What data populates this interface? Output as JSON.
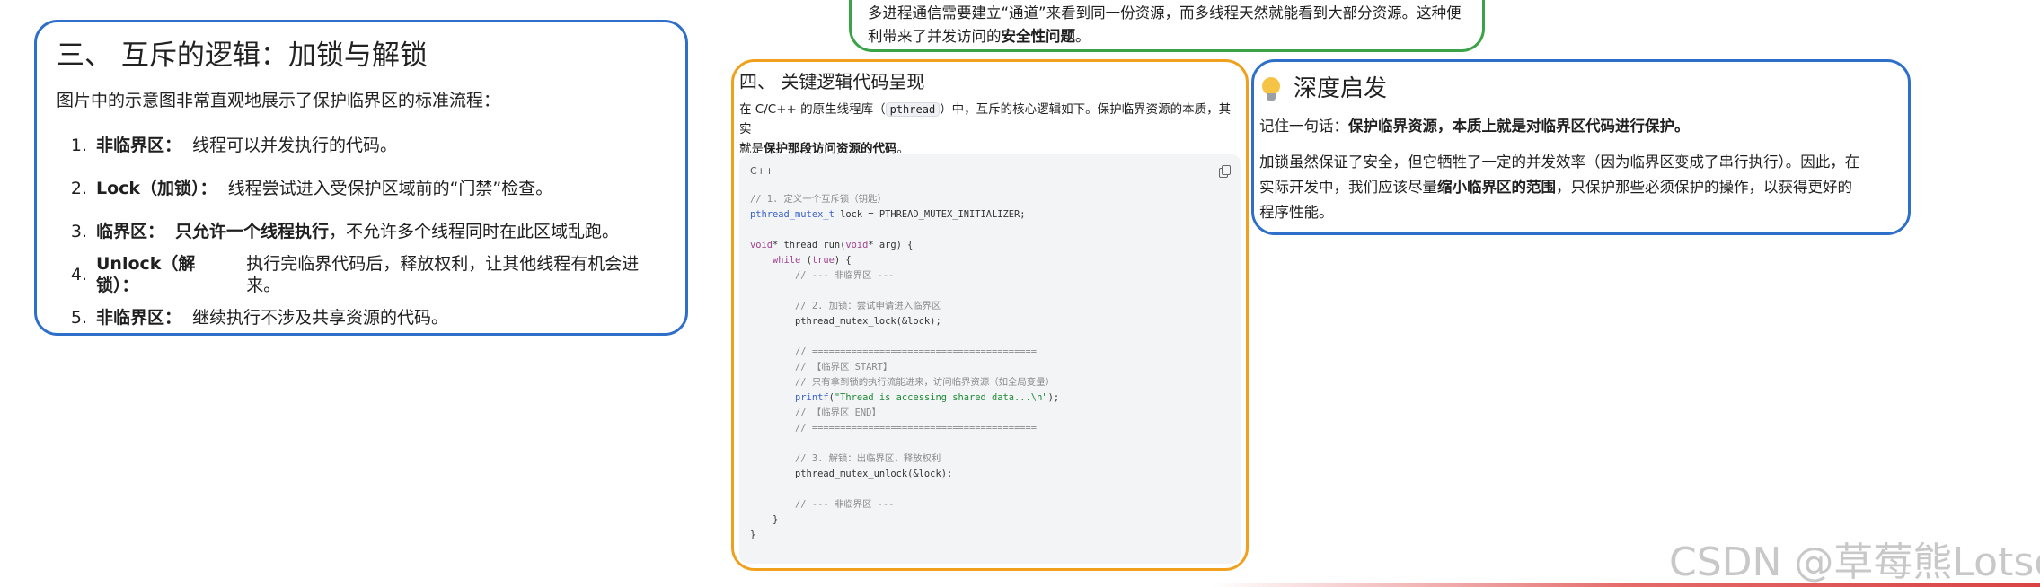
{
  "top_note": {
    "line1": "多进程通信需要建立“通道”来看到同一份资源，而多线程天然就能看到大部分资源。这种便",
    "line2_prefix": "利带来了并发访问的",
    "line2_bold": "安全性问题",
    "line2_suffix": "。"
  },
  "section3": {
    "title": "三、 互斥的逻辑：加锁与解锁",
    "intro": "图片中的示意图非常直观地展示了保护临界区的标准流程：",
    "items": [
      {
        "num": "1.",
        "term": "非临界区：",
        "text": "线程可以并发执行的代码。"
      },
      {
        "num": "2.",
        "term": "Lock（加锁）：",
        "text": "线程尝试进入受保护区域前的“门禁”检查。"
      },
      {
        "num": "3.",
        "term": "临界区：",
        "text_bold": "只允许一个线程执行",
        "text": "，不允许多个线程同时在此区域乱跑。"
      },
      {
        "num": "4.",
        "term": "Unlock（解锁）：",
        "text": "执行完临界代码后，释放权利，让其他线程有机会进来。"
      },
      {
        "num": "5.",
        "term": "非临界区：",
        "text": "继续执行不涉及共享资源的代码。"
      }
    ]
  },
  "section4": {
    "title": "四、 关键逻辑代码呈现",
    "desc_prefix": "在 C/C++ 的原生线程库（",
    "desc_code": "pthread",
    "desc_mid": "）中，互斥的核心逻辑如下。保护临界资源的本质，其实",
    "desc_line2_prefix": "就是",
    "desc_line2_bold": "保护那段访问资源的代码",
    "desc_line2_suffix": "。",
    "code_lang": "C++",
    "code_lines": [
      "// 1. 定义一个互斥锁（钥匙）",
      "pthread_mutex_t lock = PTHREAD_MUTEX_INITIALIZER;",
      "",
      "void* thread_run(void* arg) {",
      "    while (true) {",
      "        // --- 非临界区 ---",
      "",
      "        // 2. 加锁：尝试申请进入临界区",
      "        pthread_mutex_lock(&lock);",
      "",
      "        // ========================================",
      "        // 【临界区 START】",
      "        // 只有拿到锁的执行流能进来，访问临界资源（如全局变量）",
      "        printf(\"Thread is accessing shared data...\\n\");",
      "        // 【临界区 END】",
      "        // ========================================",
      "",
      "        // 3. 解锁：出临界区，释放权利",
      "        pthread_mutex_unlock(&lock);",
      "",
      "        // --- 非临界区 ---",
      "    }",
      "}"
    ]
  },
  "insight": {
    "title": "深度启发",
    "p1_prefix": "记住一句话：",
    "p1_bold": "保护临界资源，本质上就是对临界区代码进行保护。",
    "p2_a": "加锁虽然保证了安全，但它牺牲了一定的并发效率（因为临界区变成了串行执行）。因此，在",
    "p2_b_prefix": "实际开发中，我们应该尽量",
    "p2_b_bold": "缩小临界区的范围",
    "p2_b_suffix": "，只保护那些必须保护的操作，以获得更好的",
    "p2_c": "程序性能。"
  },
  "watermark": "CSDN @草莓熊Lotso",
  "colors": {
    "blue_border": "#2e6fc9",
    "orange_border": "#f0a01c",
    "green_border": "#3aa348",
    "code_bg": "#f3f4f6"
  }
}
